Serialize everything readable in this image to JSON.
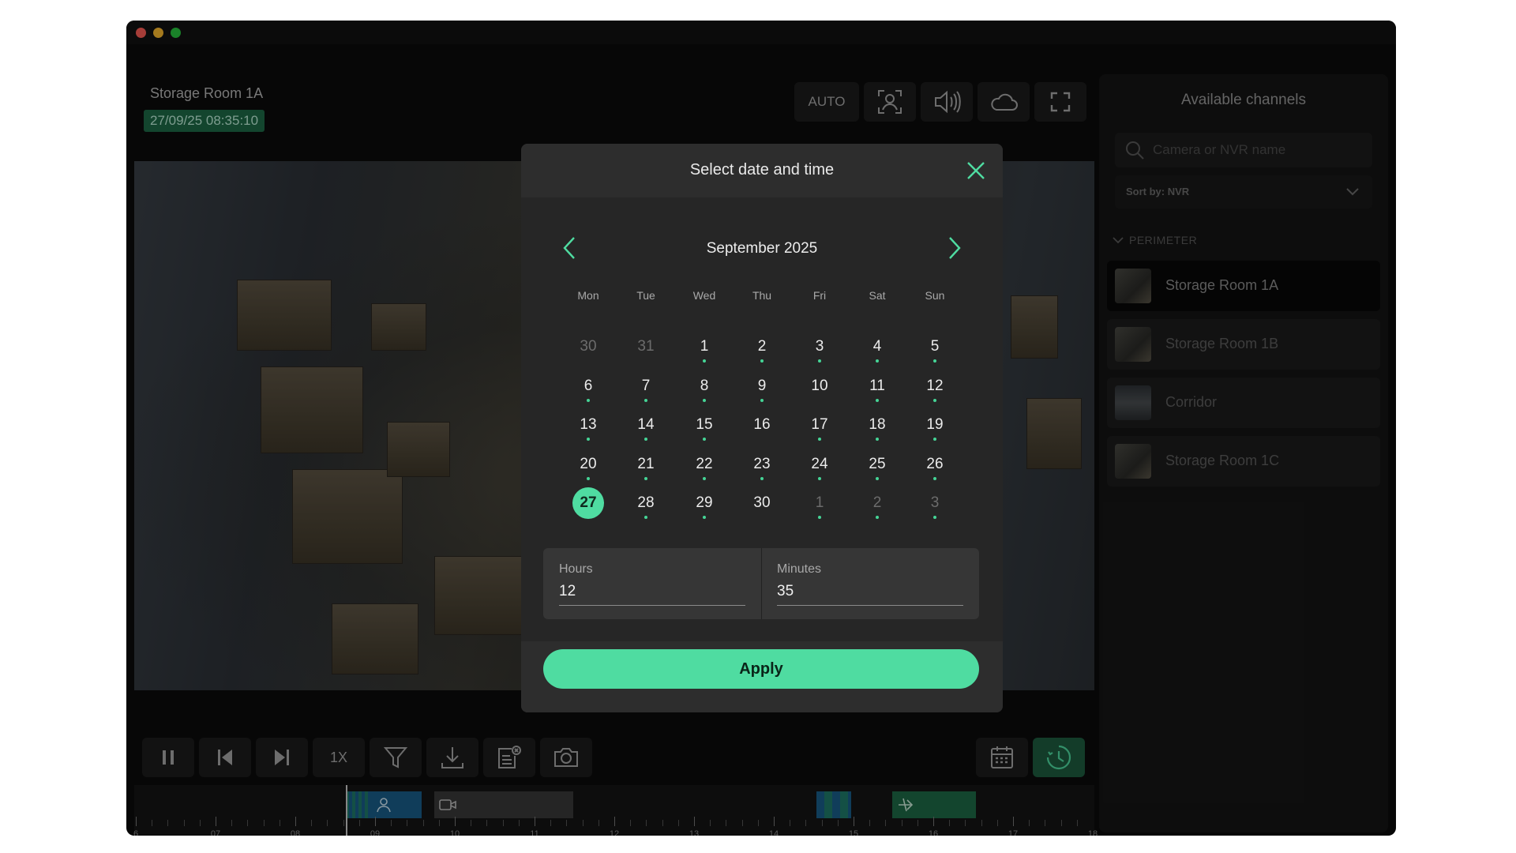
{
  "camera": {
    "title": "Storage Room 1A",
    "timestamp": "27/09/25 08:35:10"
  },
  "toolbar_top": {
    "auto_label": "AUTO",
    "icons": [
      "face-detect-icon",
      "speaker-icon",
      "cloud-icon",
      "fullscreen-icon"
    ]
  },
  "playback_controls": {
    "speed_label": "1X",
    "icons": [
      "pause-icon",
      "skip-previous-icon",
      "skip-next-icon",
      "filter-icon",
      "download-icon",
      "export-icon",
      "snapshot-icon",
      "calendar-icon",
      "history-clock-icon"
    ]
  },
  "timeline": {
    "labels": [
      "6",
      "07",
      "08",
      "09",
      "10",
      "11",
      "12",
      "13",
      "14",
      "15",
      "16",
      "17",
      "18"
    ]
  },
  "sidebar": {
    "title": "Available channels",
    "search_placeholder": "Camera or NVR name",
    "sort_label": "Sort by: NVR",
    "group_label": "PERIMETER",
    "channels": [
      {
        "label": "Storage Room 1A",
        "selected": true
      },
      {
        "label": "Storage Room 1B",
        "selected": false
      },
      {
        "label": "Corridor",
        "selected": false
      },
      {
        "label": "Storage Room 1C",
        "selected": false
      }
    ]
  },
  "modal": {
    "title": "Select date and time",
    "month_label": "September 2025",
    "weekdays": [
      "Mon",
      "Tue",
      "Wed",
      "Thu",
      "Fri",
      "Sat",
      "Sun"
    ],
    "weeks": [
      [
        {
          "d": "30",
          "muted": true,
          "dot": false
        },
        {
          "d": "31",
          "muted": true,
          "dot": false
        },
        {
          "d": "1",
          "dot": true
        },
        {
          "d": "2",
          "dot": true
        },
        {
          "d": "3",
          "dot": true
        },
        {
          "d": "4",
          "dot": true
        },
        {
          "d": "5",
          "dot": true
        }
      ],
      [
        {
          "d": "6",
          "dot": true
        },
        {
          "d": "7",
          "dot": true
        },
        {
          "d": "8",
          "dot": true
        },
        {
          "d": "9",
          "dot": true
        },
        {
          "d": "10",
          "dot": false
        },
        {
          "d": "11",
          "dot": true
        },
        {
          "d": "12",
          "dot": true
        }
      ],
      [
        {
          "d": "13",
          "dot": true
        },
        {
          "d": "14",
          "dot": true
        },
        {
          "d": "15",
          "dot": true
        },
        {
          "d": "16",
          "dot": false
        },
        {
          "d": "17",
          "dot": true
        },
        {
          "d": "18",
          "dot": true
        },
        {
          "d": "19",
          "dot": true
        }
      ],
      [
        {
          "d": "20",
          "dot": true
        },
        {
          "d": "21",
          "dot": true
        },
        {
          "d": "22",
          "dot": true
        },
        {
          "d": "23",
          "dot": true
        },
        {
          "d": "24",
          "dot": true
        },
        {
          "d": "25",
          "dot": true
        },
        {
          "d": "26",
          "dot": true
        }
      ],
      [
        {
          "d": "27",
          "selected": true,
          "dot": false
        },
        {
          "d": "28",
          "dot": true
        },
        {
          "d": "29",
          "dot": true
        },
        {
          "d": "30",
          "dot": false
        },
        {
          "d": "1",
          "muted": true,
          "dot": true
        },
        {
          "d": "2",
          "muted": true,
          "dot": true
        },
        {
          "d": "3",
          "muted": true,
          "dot": true
        }
      ]
    ],
    "hours_label": "Hours",
    "hours_value": "12",
    "minutes_label": "Minutes",
    "minutes_value": "35",
    "apply_label": "Apply"
  },
  "colors": {
    "accent": "#4fdca1",
    "timestamp_bg": "#1e6b48"
  }
}
